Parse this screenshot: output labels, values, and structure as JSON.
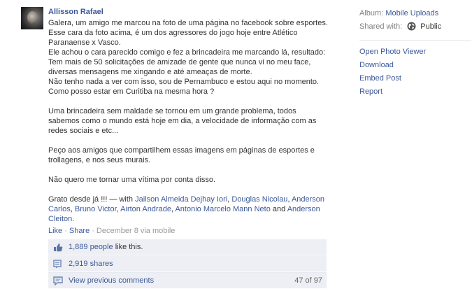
{
  "post": {
    "author": "Allisson Rafael",
    "paragraphs": [
      "Galera, um amigo me marcou na foto de uma página no facebook sobre esportes. Esse cara da foto acima, é um dos agressores do jogo hoje entre Atlético Paranaense x Vasco.",
      "Ele achou o cara parecido comigo e fez a brincadeira me marcando lá, resultado: Tem mais de 50 solicitações de amizade de gente que nunca vi no meu face, diversas mensagens me xingando e até ameaças de morte.",
      "Não tenho nada a ver com isso, sou de Pernambuco e estou aqui no momento. Como posso estar em Curitiba na mesma hora ?",
      "",
      "Uma brincadeira sem maldade se tornou em um grande problema, todos sabemos como o mundo está hoje em dia, a velocidade de informação com as redes sociais e etc...",
      "",
      "Peço aos amigos que compartilhem essas imagens em páginas de esportes e trollagens, e nos seus murais.",
      "",
      "Não quero me tornar uma vítima por conta disso.",
      ""
    ],
    "closing": "Grato desde já !!! — with",
    "tagged": [
      "Jailson Almeida Dejhay Iori",
      "Douglas Nicolau",
      "Anderson Carlos",
      "Bruno Victor",
      "Airton Andrade",
      "Antonio Marcelo Mann Neto"
    ],
    "tagged_last": "Anderson Cleiton",
    "and_word": "and",
    "like_label": "Like",
    "share_label": "Share",
    "meta": "December 8 via mobile",
    "dot": "·"
  },
  "ufi": {
    "likes": "1,889 people",
    "likes_suffix": "like this.",
    "shares": "2,919 shares",
    "view_previous": "View previous comments",
    "comment_count": "47 of 97"
  },
  "sidebar": {
    "album_label": "Album:",
    "album_value": "Mobile Uploads",
    "shared_label": "Shared with:",
    "shared_value": "Public",
    "links": [
      "Open Photo Viewer",
      "Download",
      "Embed Post",
      "Report"
    ]
  },
  "colors": {
    "link": "#3b5998",
    "ufi_bg": "#edeff4",
    "muted": "#808080"
  }
}
